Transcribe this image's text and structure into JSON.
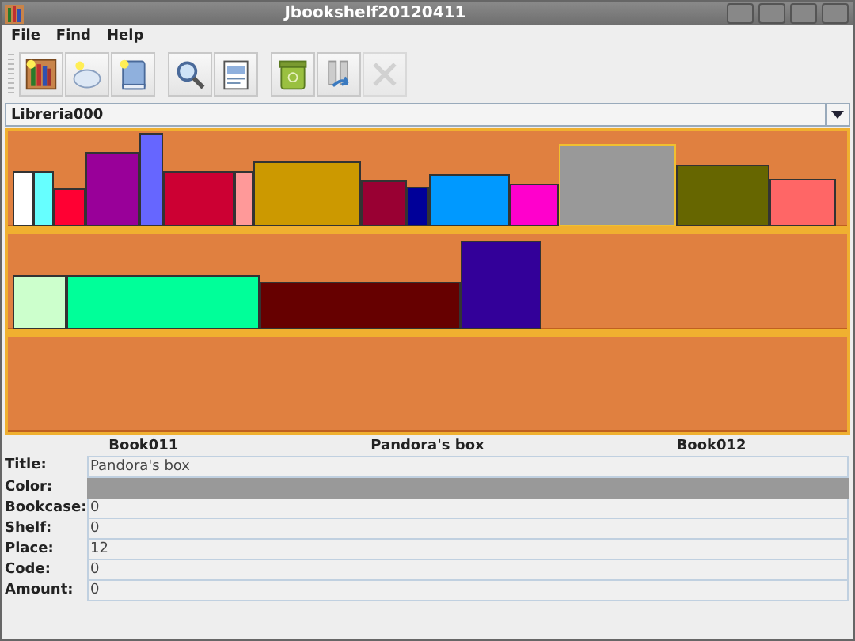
{
  "window": {
    "title": "Jbookshelf20120411"
  },
  "menu": [
    "File",
    "Find",
    "Help"
  ],
  "toolbar": [
    {
      "kind": "library",
      "disabled": false
    },
    {
      "kind": "cloud",
      "disabled": false
    },
    {
      "kind": "book",
      "disabled": false
    },
    {
      "kind": "search",
      "disabled": false
    },
    {
      "kind": "document",
      "disabled": false
    },
    {
      "kind": "trash",
      "disabled": false
    },
    {
      "kind": "import",
      "disabled": false
    },
    {
      "kind": "delete",
      "disabled": true
    }
  ],
  "library_select": {
    "value": "Libreria000"
  },
  "shelves": [
    {
      "kind": "shelf",
      "books": [
        {
          "color": "#ffffff",
          "selected": false
        },
        {
          "color": "#66ffff",
          "selected": false
        },
        {
          "color": "#ff0033",
          "selected": false
        },
        {
          "color": "#990099",
          "selected": false
        },
        {
          "color": "#6666ff",
          "selected": false
        },
        {
          "color": "#cc0033",
          "selected": false
        },
        {
          "color": "#ff9999",
          "selected": false
        },
        {
          "color": "#cc9900",
          "selected": false
        },
        {
          "color": "#990033",
          "selected": false
        },
        {
          "color": "#000099",
          "selected": false
        },
        {
          "color": "#0099ff",
          "selected": false
        },
        {
          "color": "#ff00cc",
          "selected": false
        },
        {
          "color": "#999999",
          "selected": true
        },
        {
          "color": "#666600",
          "selected": false
        },
        {
          "color": "#ff6666",
          "selected": false
        }
      ]
    },
    {
      "kind": "shelf",
      "books": [
        {
          "color": "#ccffcc",
          "selected": false
        },
        {
          "color": "#00ff99",
          "selected": false
        },
        {
          "color": "#660000",
          "selected": false
        },
        {
          "color": "#330099",
          "selected": false
        }
      ]
    },
    {
      "kind": "shelf"
    }
  ],
  "navigation": {
    "previous": "Book011",
    "current": "Pandora's box",
    "next": "Book012"
  },
  "properties": [
    {
      "label": "Title:",
      "value": "Pandora's box"
    },
    {
      "label": "Color:",
      "color": "#999999"
    },
    {
      "label": "Bookcase:",
      "value": "0"
    },
    {
      "label": "Shelf:",
      "value": "0"
    },
    {
      "label": "Place:",
      "value": "12"
    },
    {
      "label": "Code:",
      "value": "0"
    },
    {
      "label": "Amount:",
      "value": "0"
    }
  ]
}
